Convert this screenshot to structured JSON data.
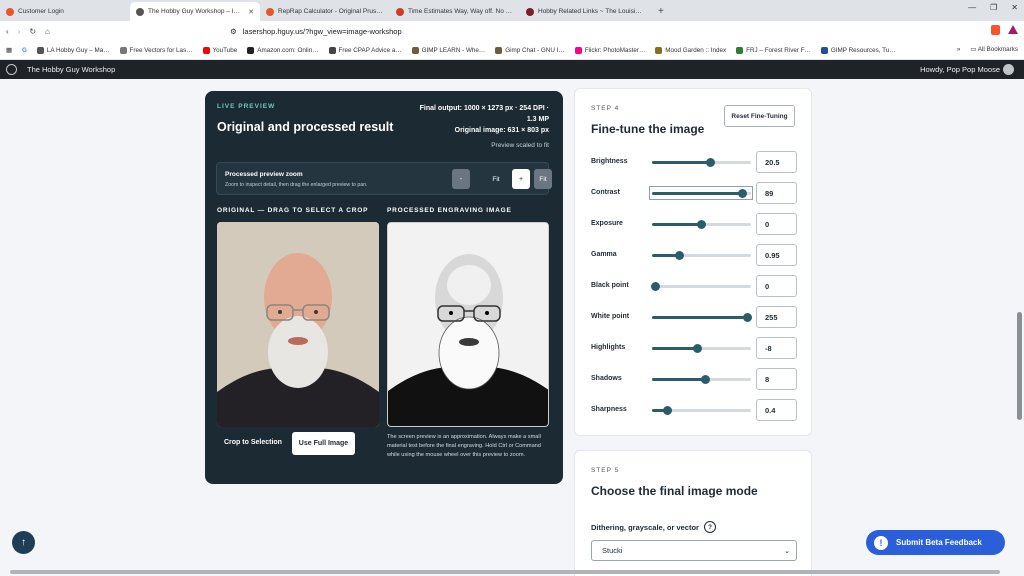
{
  "browser": {
    "tabs": [
      {
        "title": "Customer Login",
        "color": "#e8562a",
        "active": false
      },
      {
        "title": "The Hobby Guy Workshop – Ima…",
        "color": "#555555",
        "active": true
      },
      {
        "title": "RepRap Calculator - Original Prusa 3…",
        "color": "#e8562a",
        "active": false
      },
      {
        "title": "Time Estimates Way, Way off. No oth…",
        "color": "#d33a2c",
        "active": false
      },
      {
        "title": "Hobby Related Links ~ The Louisiana…",
        "color": "#7a1f2b",
        "active": false
      }
    ],
    "new_tab": "+",
    "url": "lasershop.hguy.us/?hgw_view=image-workshop",
    "bookmarks": [
      {
        "label": "LA Hobby Guy – Ma…",
        "color": "#555555"
      },
      {
        "label": "Free Vectors for Las…",
        "color": "#777777"
      },
      {
        "label": "YouTube",
        "color": "#ff0000"
      },
      {
        "label": "Amazon.com: Onlin…",
        "color": "#222222"
      },
      {
        "label": "Free CPAP Advice a…",
        "color": "#444444"
      },
      {
        "label": "GIMP LEARN - Whe…",
        "color": "#6b5e3f"
      },
      {
        "label": "Gimp Chat - GNU I…",
        "color": "#6b5e3f"
      },
      {
        "label": "Flickr: PhotoMaster…",
        "color": "#ff0084"
      },
      {
        "label": "Mood Garden :: Index",
        "color": "#8a6d1e"
      },
      {
        "label": "FRJ – Forest River F…",
        "color": "#2e7d32"
      },
      {
        "label": "GIMP Resources, Tu…",
        "color": "#1e4fa0"
      }
    ],
    "bookmarks_more": "»",
    "all_bookmarks": "All Bookmarks"
  },
  "adminbar": {
    "site_name": "The Hobby Guy Workshop",
    "howdy": "Howdy, Pop Pop Moose"
  },
  "preview": {
    "live_label": "LIVE PREVIEW",
    "title": "Original and processed result",
    "final_output": "Final output: 1000 × 1273 px · 254 DPI · 1.3 MP",
    "original_image": "Original image: 631 × 803 px",
    "scaled_note": "Preview scaled to fit",
    "zoom_title": "Processed preview zoom",
    "zoom_help": "Zoom to inspect detail, then drag the enlarged preview to pan.",
    "zoom_minus": "-",
    "zoom_level": "Fit",
    "zoom_plus": "+",
    "zoom_fit": "Fit",
    "original_label": "ORIGINAL — DRAG TO SELECT A CROP",
    "processed_label": "PROCESSED ENGRAVING IMAGE",
    "crop_button": "Crop to Selection",
    "full_button": "Use Full Image",
    "note": "The screen preview is an approximation. Always make a small material test before the final engraving. Hold Ctrl or Command while using the mouse wheel over this preview to zoom."
  },
  "step4": {
    "step_label": "STEP 4",
    "title": "Fine-tune the image",
    "reset_button": "Reset Fine-Tuning",
    "sliders": [
      {
        "name": "Brightness",
        "value": "20.5",
        "fraction": 0.59
      },
      {
        "name": "Contrast",
        "value": "89",
        "fraction": 0.91
      },
      {
        "name": "Exposure",
        "value": "0",
        "fraction": 0.5
      },
      {
        "name": "Gamma",
        "value": "0.95",
        "fraction": 0.28
      },
      {
        "name": "Black point",
        "value": "0",
        "fraction": 0.04
      },
      {
        "name": "White point",
        "value": "255",
        "fraction": 0.96
      },
      {
        "name": "Highlights",
        "value": "-8",
        "fraction": 0.46
      },
      {
        "name": "Shadows",
        "value": "8",
        "fraction": 0.54
      },
      {
        "name": "Sharpness",
        "value": "0.4",
        "fraction": 0.16
      }
    ]
  },
  "step5": {
    "step_label": "STEP 5",
    "title": "Choose the final image mode",
    "mode_label": "Dithering, grayscale, or vector",
    "help": "?",
    "selected_mode": "Stucki"
  },
  "feedback_button": "Submit Beta Feedback",
  "colors": {
    "accent": "#2a5c6b",
    "dark_panel": "#1c2a33",
    "feedback": "#2b5fd9"
  }
}
